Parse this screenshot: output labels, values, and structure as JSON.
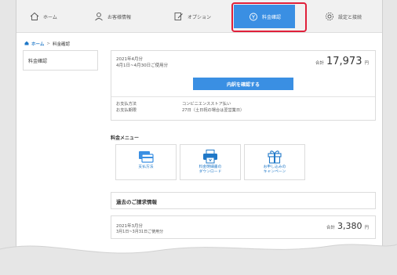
{
  "nav": {
    "items": [
      {
        "label": "ホーム",
        "icon": "home-icon"
      },
      {
        "label": "お客様情報",
        "icon": "user-icon"
      },
      {
        "label": "オプション",
        "icon": "edit-icon"
      },
      {
        "label": "料金確認",
        "icon": "coin-icon"
      },
      {
        "label": "設定と接続",
        "icon": "gear-icon"
      }
    ],
    "active_color": "#3a8fe3",
    "highlight_color": "#e0203a"
  },
  "breadcrumb": {
    "home": "ホーム",
    "separator": ">",
    "current": "料金確認"
  },
  "side_tab": {
    "label": "料金確認"
  },
  "summary": {
    "month": "2021年4月分",
    "range": "4月1日~4月30日ご使用分",
    "total_label": "合計",
    "total_amount": "17,973",
    "unit": "円",
    "detail_button": "内訳を確認する",
    "payment_method_label": "お支払方法",
    "payment_method_value": "コンビニエンスストア払い",
    "payment_date_label": "お支払期限",
    "payment_date_value": "27日（土日祝の場合は翌営業日）"
  },
  "fee_menu": {
    "title": "料金メニュー",
    "cards": [
      {
        "label": "支払方法",
        "icon": "card-icon"
      },
      {
        "label": "料金明細書の\nダウンロード",
        "icon": "printer-icon"
      },
      {
        "label": "お申し込みの\nキャンペーン",
        "icon": "gift-icon"
      }
    ]
  },
  "past_bills": {
    "title": "過去のご請求情報",
    "items": [
      {
        "month": "2021年3月分",
        "range": "3月1日~3月31日ご使用分",
        "total_label": "合計",
        "amount": "3,380",
        "unit": "円"
      }
    ]
  }
}
